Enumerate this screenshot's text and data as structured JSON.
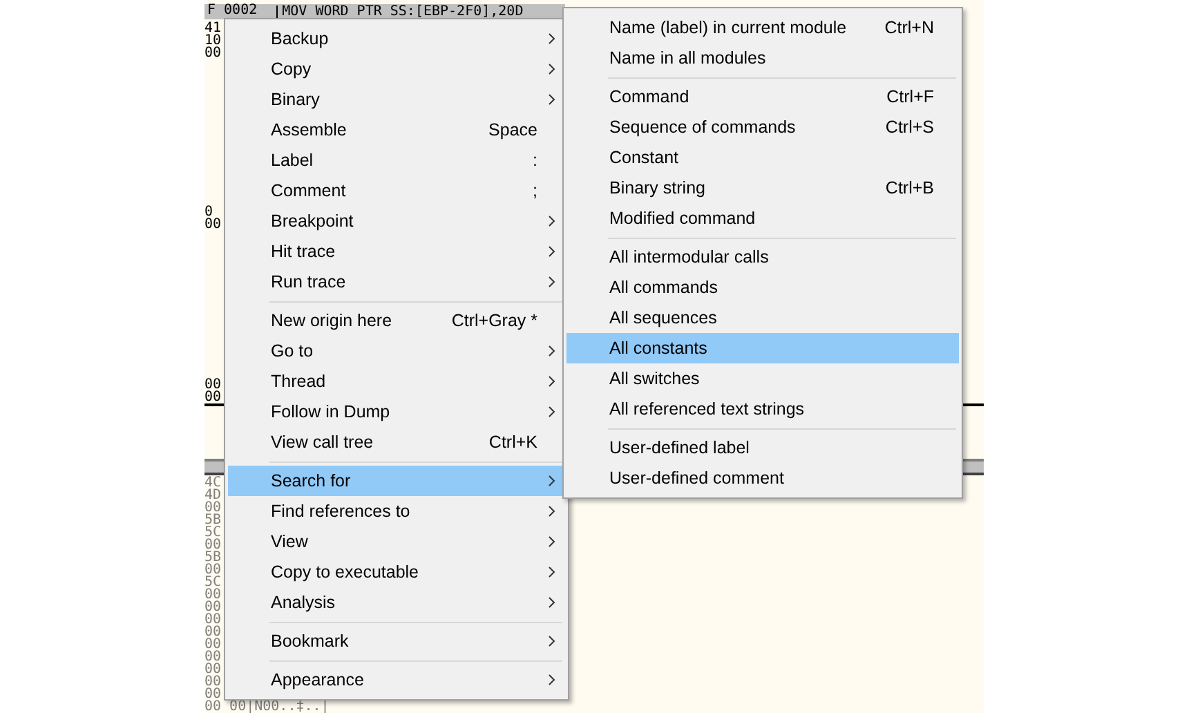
{
  "code_row": {
    "address": "F 0002",
    "instruction": "MOV WORD PTR SS:[EBP-2F0],20D",
    "selected": true
  },
  "upper_dump": [
    [
      "41",
      "10",
      "00"
    ],
    [
      "0",
      "00"
    ],
    [
      "00",
      "00"
    ]
  ],
  "lower_dump": [
    "4C",
    "4D",
    "00",
    "5B",
    "5C",
    "00",
    "5B",
    "00",
    "5C",
    "00",
    "00",
    "00",
    "00",
    "00",
    "00",
    "00",
    "00",
    "00"
  ],
  "lower_last_row": "00 00|N00..‡..|",
  "context_menu": {
    "groups": [
      {
        "items": [
          {
            "label": "Backup",
            "has_submenu": true,
            "selected": false
          },
          {
            "label": "Copy",
            "has_submenu": true,
            "selected": false
          },
          {
            "label": "Binary",
            "has_submenu": true,
            "selected": false
          },
          {
            "label": "Assemble",
            "shortcut": "Space",
            "has_submenu": false,
            "selected": false
          },
          {
            "label": "Label",
            "shortcut": ":",
            "has_submenu": false,
            "selected": false
          },
          {
            "label": "Comment",
            "shortcut": ";",
            "has_submenu": false,
            "selected": false
          },
          {
            "label": "Breakpoint",
            "has_submenu": true,
            "selected": false
          },
          {
            "label": "Hit trace",
            "has_submenu": true,
            "selected": false
          },
          {
            "label": "Run trace",
            "has_submenu": true,
            "selected": false
          }
        ]
      },
      {
        "items": [
          {
            "label": "New origin here",
            "shortcut": "Ctrl+Gray *",
            "has_submenu": false,
            "selected": false
          },
          {
            "label": "Go to",
            "has_submenu": true,
            "selected": false
          },
          {
            "label": "Thread",
            "has_submenu": true,
            "selected": false
          },
          {
            "label": "Follow in Dump",
            "has_submenu": true,
            "selected": false
          },
          {
            "label": "View call tree",
            "shortcut": "Ctrl+K",
            "has_submenu": false,
            "selected": false
          }
        ]
      },
      {
        "items": [
          {
            "label": "Search for",
            "has_submenu": true,
            "selected": true
          },
          {
            "label": "Find references to",
            "has_submenu": true,
            "selected": false
          },
          {
            "label": "View",
            "has_submenu": true,
            "selected": false
          },
          {
            "label": "Copy to executable",
            "has_submenu": true,
            "selected": false
          },
          {
            "label": "Analysis",
            "has_submenu": true,
            "selected": false
          }
        ]
      },
      {
        "items": [
          {
            "label": "Bookmark",
            "has_submenu": true,
            "selected": false
          }
        ]
      },
      {
        "items": [
          {
            "label": "Appearance",
            "has_submenu": true,
            "selected": false
          }
        ]
      }
    ]
  },
  "submenu": {
    "groups": [
      {
        "items": [
          {
            "label": "Name (label) in current module",
            "shortcut": "Ctrl+N",
            "selected": false
          },
          {
            "label": "Name in all modules",
            "selected": false
          }
        ]
      },
      {
        "items": [
          {
            "label": "Command",
            "shortcut": "Ctrl+F",
            "selected": false
          },
          {
            "label": "Sequence of commands",
            "shortcut": "Ctrl+S",
            "selected": false
          },
          {
            "label": "Constant",
            "selected": false
          },
          {
            "label": "Binary string",
            "shortcut": "Ctrl+B",
            "selected": false
          },
          {
            "label": "Modified command",
            "selected": false
          }
        ]
      },
      {
        "items": [
          {
            "label": "All intermodular calls",
            "selected": false
          },
          {
            "label": "All commands",
            "selected": false
          },
          {
            "label": "All sequences",
            "selected": false
          },
          {
            "label": "All constants",
            "selected": true
          },
          {
            "label": "All switches",
            "selected": false
          },
          {
            "label": "All referenced text strings",
            "selected": false
          }
        ]
      },
      {
        "items": [
          {
            "label": "User-defined label",
            "selected": false
          },
          {
            "label": "User-defined comment",
            "selected": false
          }
        ]
      }
    ]
  }
}
